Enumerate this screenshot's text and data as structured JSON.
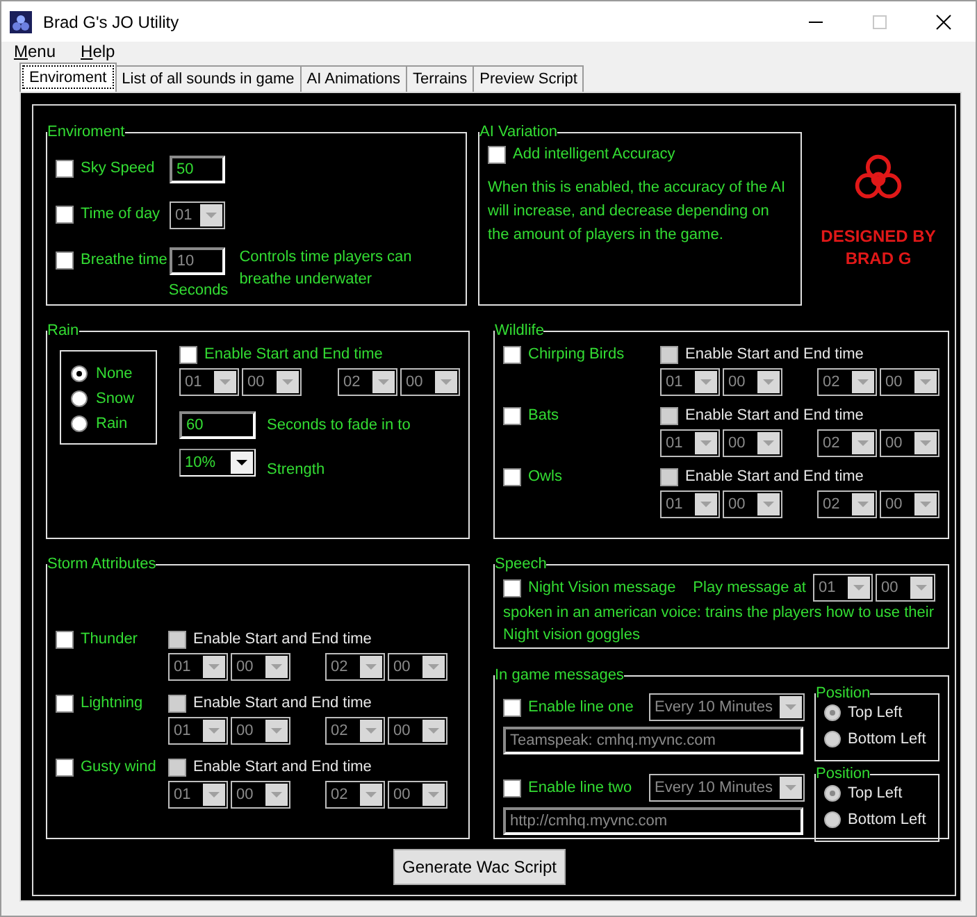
{
  "window": {
    "title": "Brad G's JO Utility"
  },
  "menu": [
    {
      "label": "Menu"
    },
    {
      "label": "Help"
    }
  ],
  "tabs": [
    {
      "label": "Enviroment",
      "selected": true
    },
    {
      "label": "List of all sounds in game",
      "selected": false
    },
    {
      "label": "AI Animations",
      "selected": false
    },
    {
      "label": "Terrains",
      "selected": false
    },
    {
      "label": "Preview Script",
      "selected": false
    }
  ],
  "environment": {
    "title": "Enviroment",
    "rows": [
      {
        "kind": "input",
        "label": "Sky Speed",
        "checked": false,
        "value": "50",
        "disabled": false
      },
      {
        "kind": "combo",
        "label": "Time of day",
        "checked": false,
        "value": "01",
        "disabled": true
      },
      {
        "kind": "input",
        "label": "Breathe time",
        "checked": false,
        "value": "10",
        "disabled": true,
        "unit": "Seconds",
        "note": "Controls time players can breathe underwater"
      }
    ]
  },
  "ai_variation": {
    "title": "AI Variation",
    "label": "Add intelligent Accuracy",
    "checked": false,
    "description": "When this is enabled, the accuracy of the AI will increase, and decrease depending on the  amount of players in the game."
  },
  "logo": {
    "text": "DESIGNED BY BRAD G"
  },
  "rain": {
    "title": "Rain",
    "options": [
      {
        "label": "None",
        "selected": true
      },
      {
        "label": "Snow",
        "selected": false
      },
      {
        "label": "Rain",
        "selected": false
      }
    ],
    "schedule": {
      "label": "Enable Start and End time",
      "checked": false,
      "disabled": false,
      "times_disabled": true,
      "start": [
        "01",
        "00"
      ],
      "end": [
        "02",
        "00"
      ]
    },
    "fade": {
      "value": "60",
      "label": "Seconds to fade in to",
      "disabled": false
    },
    "strength": {
      "value": "10%",
      "label": "Strength",
      "disabled": false
    }
  },
  "wildlife": {
    "title": "Wildlife",
    "items": [
      {
        "label": "Chirping Birds",
        "checked": false,
        "schedule": {
          "label": "Enable Start and End time",
          "checked": false,
          "disabled": true,
          "times_disabled": true,
          "start": [
            "01",
            "00"
          ],
          "end": [
            "02",
            "00"
          ]
        }
      },
      {
        "label": "Bats",
        "checked": false,
        "schedule": {
          "label": "Enable Start and End time",
          "checked": false,
          "disabled": true,
          "times_disabled": true,
          "start": [
            "01",
            "00"
          ],
          "end": [
            "02",
            "00"
          ]
        }
      },
      {
        "label": "Owls",
        "checked": false,
        "schedule": {
          "label": "Enable Start and End time",
          "checked": false,
          "disabled": true,
          "times_disabled": true,
          "start": [
            "01",
            "00"
          ],
          "end": [
            "02",
            "00"
          ]
        }
      }
    ]
  },
  "storm": {
    "title": "Storm Attributes",
    "items": [
      {
        "label": "Thunder",
        "checked": false,
        "schedule": {
          "label": "Enable Start and End time",
          "checked": false,
          "disabled": true,
          "times_disabled": true,
          "start": [
            "01",
            "00"
          ],
          "end": [
            "02",
            "00"
          ]
        }
      },
      {
        "label": "Lightning",
        "checked": false,
        "schedule": {
          "label": "Enable Start and End time",
          "checked": false,
          "disabled": true,
          "times_disabled": true,
          "start": [
            "01",
            "00"
          ],
          "end": [
            "02",
            "00"
          ]
        }
      },
      {
        "label": "Gusty wind",
        "checked": false,
        "schedule": {
          "label": "Enable Start and End time",
          "checked": false,
          "disabled": true,
          "times_disabled": true,
          "start": [
            "01",
            "00"
          ],
          "end": [
            "02",
            "00"
          ]
        }
      }
    ]
  },
  "speech": {
    "title": "Speech",
    "label": "Night Vision message",
    "checked": false,
    "play_label": "Play message at",
    "time": [
      "01",
      "00"
    ],
    "time_disabled": true,
    "description": "spoken in an american voice: trains the players how to use their Night vision goggles"
  },
  "in_game_messages": {
    "title": "In game messages",
    "lines": [
      {
        "label": "Enable line one",
        "checked": false,
        "interval": "Every 10 Minutes",
        "text": "Teamspeak: cmhq.myvnc.com",
        "disabled": true,
        "position": {
          "title": "Position",
          "disabled": true,
          "options": [
            {
              "label": "Top Left",
              "selected": true
            },
            {
              "label": "Bottom Left",
              "selected": false
            }
          ]
        }
      },
      {
        "label": "Enable line two",
        "checked": false,
        "interval": "Every 10 Minutes",
        "text": "http://cmhq.myvnc.com",
        "disabled": true,
        "position": {
          "title": "Position",
          "disabled": true,
          "options": [
            {
              "label": "Top Left",
              "selected": true
            },
            {
              "label": "Bottom Left",
              "selected": false
            }
          ]
        }
      }
    ]
  },
  "generate_button": "Generate Wac Script"
}
